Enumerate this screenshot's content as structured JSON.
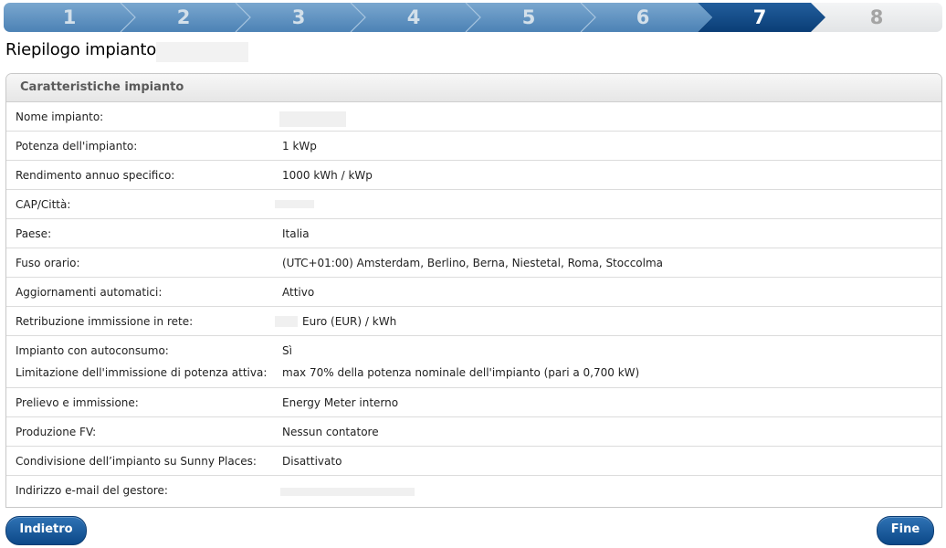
{
  "steps": [
    {
      "label": "1",
      "state": "done"
    },
    {
      "label": "2",
      "state": "done"
    },
    {
      "label": "3",
      "state": "done"
    },
    {
      "label": "4",
      "state": "done"
    },
    {
      "label": "5",
      "state": "done"
    },
    {
      "label": "6",
      "state": "done"
    },
    {
      "label": "7",
      "state": "active"
    },
    {
      "label": "8",
      "state": "future"
    }
  ],
  "page_title": "Riepilogo impianto",
  "panel": {
    "title": "Caratteristiche impianto",
    "rows": [
      {
        "label": "Nome impianto:",
        "value": ""
      },
      {
        "label": "Potenza dell'impianto:",
        "value": "1 kWp"
      },
      {
        "label": "Rendimento annuo specifico:",
        "value": "1000 kWh / kWp"
      },
      {
        "label": "CAP/Città:",
        "value": ""
      },
      {
        "label": "Paese:",
        "value": "Italia"
      },
      {
        "label": "Fuso orario:",
        "value": "(UTC+01:00) Amsterdam, Berlino, Berna, Niestetal, Roma, Stoccolma"
      },
      {
        "label": "Aggiornamenti automatici:",
        "value": "Attivo"
      },
      {
        "label": "Retribuzione immissione in rete:",
        "value": "Euro (EUR) / kWh"
      },
      {
        "label": "Impianto con autoconsumo:",
        "value": "Sì",
        "label2": "Limitazione dell'immissione di potenza attiva:",
        "value2": "max 70% della potenza nominale dell'impianto (pari a 0,700 kW)"
      },
      {
        "label": "Prelievo e immissione:",
        "value": "Energy Meter interno"
      },
      {
        "label": "Produzione FV:",
        "value": "Nessun contatore"
      },
      {
        "label": "Condivisione dell’impianto su Sunny Places:",
        "value": "Disattivato"
      },
      {
        "label": "Indirizzo e-mail del gestore:",
        "value": ""
      }
    ]
  },
  "buttons": {
    "back": "Indietro",
    "finish": "Fine"
  },
  "colors": {
    "step_done": "#5f93c2",
    "step_active": "#0f4a86",
    "step_future": "#e9ecef",
    "button": "#1a5a9c"
  }
}
